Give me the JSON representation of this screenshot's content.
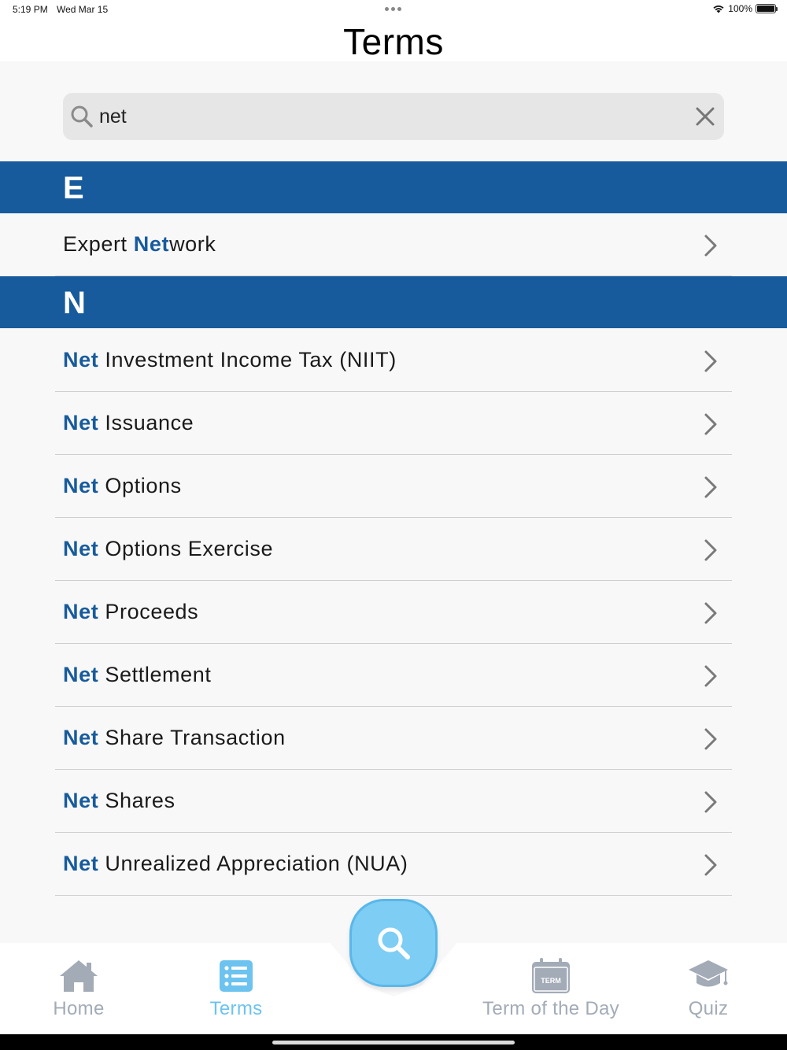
{
  "status_bar": {
    "time": "5:19 PM",
    "date": "Wed Mar 15",
    "battery": "100%"
  },
  "header": {
    "title": "Terms"
  },
  "search": {
    "value": "net",
    "placeholder": "Search"
  },
  "sections": [
    {
      "letter": "E",
      "items": [
        {
          "before": "Expert ",
          "highlight": "Net",
          "after": "work"
        }
      ]
    },
    {
      "letter": "N",
      "items": [
        {
          "before": "",
          "highlight": "Net",
          "after": " Investment Income Tax (NIIT)"
        },
        {
          "before": "",
          "highlight": "Net",
          "after": " Issuance"
        },
        {
          "before": "",
          "highlight": "Net",
          "after": " Options"
        },
        {
          "before": "",
          "highlight": "Net",
          "after": " Options Exercise"
        },
        {
          "before": "",
          "highlight": "Net",
          "after": " Proceeds"
        },
        {
          "before": "",
          "highlight": "Net",
          "after": " Settlement"
        },
        {
          "before": "",
          "highlight": "Net",
          "after": " Share Transaction"
        },
        {
          "before": "",
          "highlight": "Net",
          "after": " Shares"
        },
        {
          "before": "",
          "highlight": "Net",
          "after": " Unrealized Appreciation (NUA)"
        }
      ]
    }
  ],
  "tabs": {
    "home": "Home",
    "terms": "Terms",
    "term_of_day": "Term of the Day",
    "term_badge": "TERM",
    "quiz": "Quiz"
  },
  "icons": {
    "search": "search-icon",
    "clear": "close-icon",
    "chevron": "chevron-right-icon",
    "home": "house-icon",
    "terms": "list-icon",
    "term_of_day": "calendar-icon",
    "quiz": "graduation-cap-icon"
  },
  "colors": {
    "section_header": "#175b9c",
    "highlight": "#175b9c",
    "tab_active": "#6cc3f0",
    "tab_inactive": "#a3abb7",
    "fab": "#7dcdf4"
  }
}
